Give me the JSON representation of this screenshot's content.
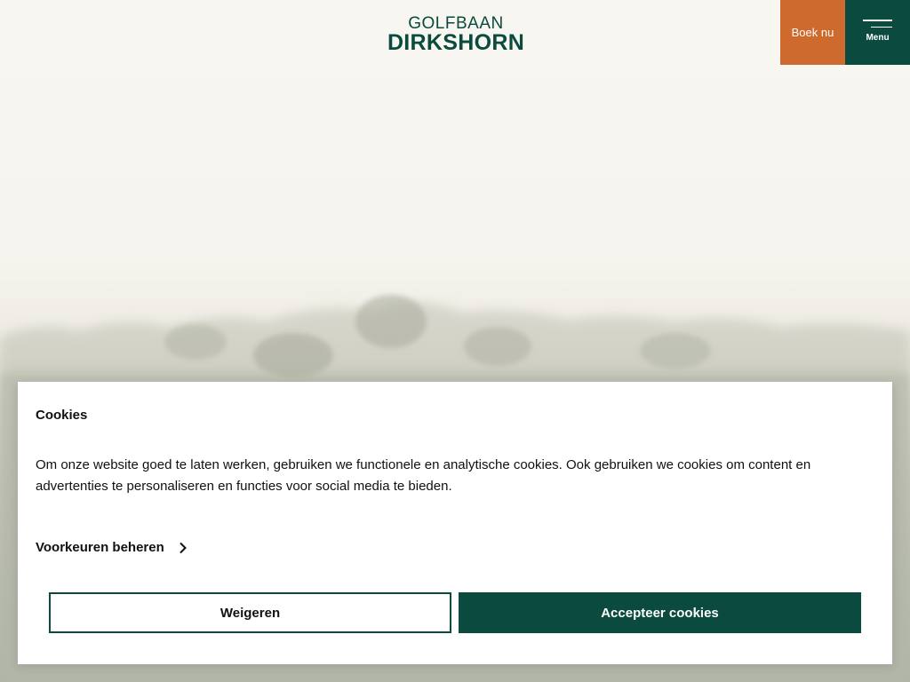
{
  "header": {
    "logo": {
      "line1": "GOLFBAAN",
      "line2": "DIRKSHORN"
    },
    "book_label": "Boek nu",
    "menu_label": "Menu"
  },
  "cookie_dialog": {
    "title": "Cookies",
    "body": "Om onze website goed te laten werken, gebruiken we functionele en analytische cookies. Ook gebruiken we cookies om content en advertenties te personaliseren en functies voor social media te bieden.",
    "preferences_label": "Voorkeuren beheren",
    "refuse_label": "Weigeren",
    "accept_label": "Accepteer cookies"
  },
  "colors": {
    "brand_green": "#0b4a3f",
    "accent_orange": "#cf6a2e",
    "background": "#f7f5f0"
  },
  "icons": [
    "hamburger-icon",
    "chevron-right-icon"
  ]
}
